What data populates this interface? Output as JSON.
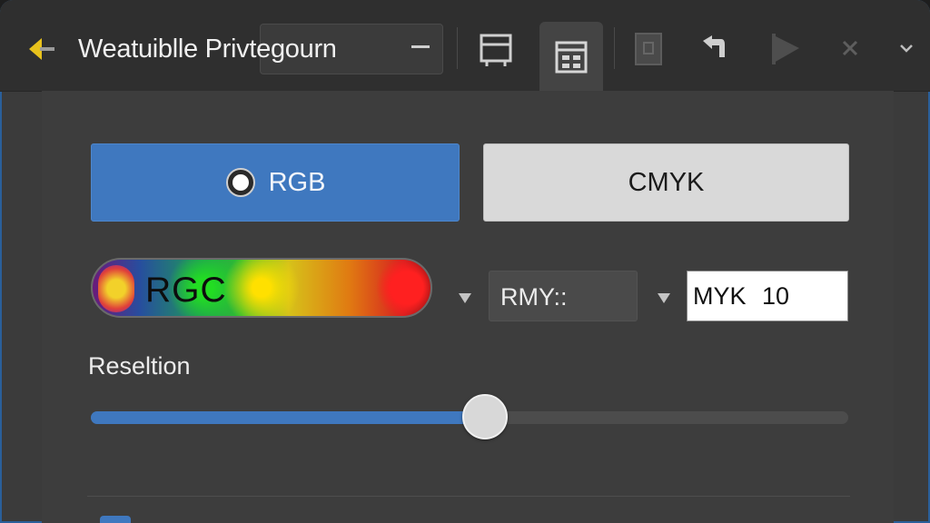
{
  "window": {
    "title": "Weatuiblle Privtegourn",
    "accent": "#3f78bf"
  },
  "toolbar": {
    "icons": [
      "back-arrow-icon",
      "minimize-icon",
      "print-frame-icon",
      "layout-grid-icon",
      "page-icon",
      "undo-hand-icon",
      "flag-icon",
      "close-icon",
      "chevron-down-icon"
    ]
  },
  "mode": {
    "rgb_label": "RGB",
    "cmyk_label": "CMYK",
    "selected": "RGB"
  },
  "gradient": {
    "label": "RGC"
  },
  "dropdown": {
    "value": "RMY::"
  },
  "input": {
    "value": "MYK 10"
  },
  "resolution": {
    "label": "Reseltion",
    "value_fraction": 0.52
  }
}
